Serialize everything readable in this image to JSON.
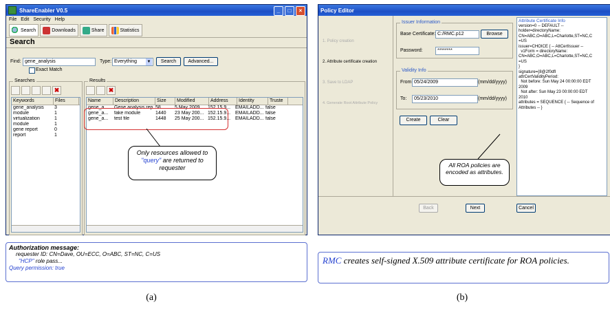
{
  "left_window": {
    "title": "ShareEnabler  V0.5",
    "menu": [
      "File",
      "Edit",
      "Security",
      "Help"
    ],
    "toolbar": [
      "Search",
      "Downloads",
      "Share",
      "Statistics"
    ],
    "section_title": "Search",
    "find_label": "Find:",
    "find_value": "gene_analysis",
    "type_label": "Type:",
    "type_value": "Everything",
    "search_button": "Search",
    "advanced_button": "Advanced...",
    "exact_match": "Exact Match",
    "searches_label": "Searches",
    "results_label": "Results",
    "searches_columns": [
      "Keywords",
      "Files"
    ],
    "searches_rows": [
      [
        "gene_analysis",
        "3"
      ],
      [
        "module",
        "1"
      ],
      [
        "virtualization",
        "1"
      ],
      [
        "module",
        "1"
      ],
      [
        "gene report",
        "0"
      ],
      [
        "report",
        "1"
      ]
    ],
    "results_columns": [
      "Name",
      "Description",
      "Size",
      "Modified",
      "Address",
      "Identity",
      "Truste"
    ],
    "results_rows": [
      [
        "gene_a...",
        "Gene analysis rep...",
        "58...",
        "5 May 2009...",
        "152.15.9...",
        "EMAILADD...",
        "false"
      ],
      [
        "gene_a...",
        "fake module",
        "1440",
        "23 May 200...",
        "152.15.9...",
        "EMAILADD...",
        "false"
      ],
      [
        "gene_a...",
        "test file",
        "1448",
        "25 May 200...",
        "152.15.9...",
        "EMAILADD...",
        "false"
      ]
    ],
    "callout_pre": "Only resources allowed to ",
    "callout_query": "\"query\"",
    "callout_post": " are returned to requester"
  },
  "auth_box": {
    "heading": "Authorization message:",
    "line1": "requester ID: CN=Dave, OU=ECC, O=ABC, ST=NC, C=US",
    "line2_hcp": "\"HCP\"",
    "line2_rest": " role pass...",
    "line3": "Query permission: true"
  },
  "right_window": {
    "title": "Policy Editor",
    "steps": [
      "1. Policy creation",
      "2. Attribute certificate creation",
      "3. Save to LDAP",
      "4. Generate Root Attribute Policy"
    ],
    "issuer_info_label": "Issuer Information",
    "base_cert_label": "Base Certificate:",
    "base_cert_value": "C:/RMC.p12",
    "browse_button": "Browse",
    "password_label": "Password:",
    "password_value": "********",
    "validity_label": "Validity Info",
    "from_label": "From:",
    "from_value": "05/24/2009",
    "to_label": "To:",
    "to_value": "05/23/2010",
    "date_format": "(mm/dd/yyyy)",
    "create_button": "Create",
    "clear_button": "Clear",
    "cert_info_label": "Attribute Certificate Info",
    "cert_info_lines": [
      "version=0 -- DEFAULT --",
      "holder=directoryName:",
      "CN=ABC,O=ABC,L=Charlotte,ST=NC,C",
      "=US",
      "issuer=CHOICE { -- AttCertIssuer --",
      "  v1Form = directoryName:",
      "CN=ABC,O=ABC,L=Charlotte,ST=NC,C",
      "=US",
      "}",
      "signature={8@2f0dfl",
      "attrCertValidityPeriod:",
      "  Not before: Sun May 24 00:00:00 EDT",
      "2009",
      "  Not after: Sun May 23 00:00:00 EDT",
      "2010",
      "attributes = SEQUENCE { -- Sequence of",
      "Attributes -- }"
    ],
    "callout": "All ROA policies are encoded as attributes.",
    "back_button": "Back",
    "next_button": "Next",
    "cancel_button": "Cancel"
  },
  "rmc_box": {
    "rmc": "RMC",
    "text": " creates self-signed X.509 attribute certificate for ROA policies."
  },
  "labels": {
    "a": "(a)",
    "b": "(b)"
  }
}
